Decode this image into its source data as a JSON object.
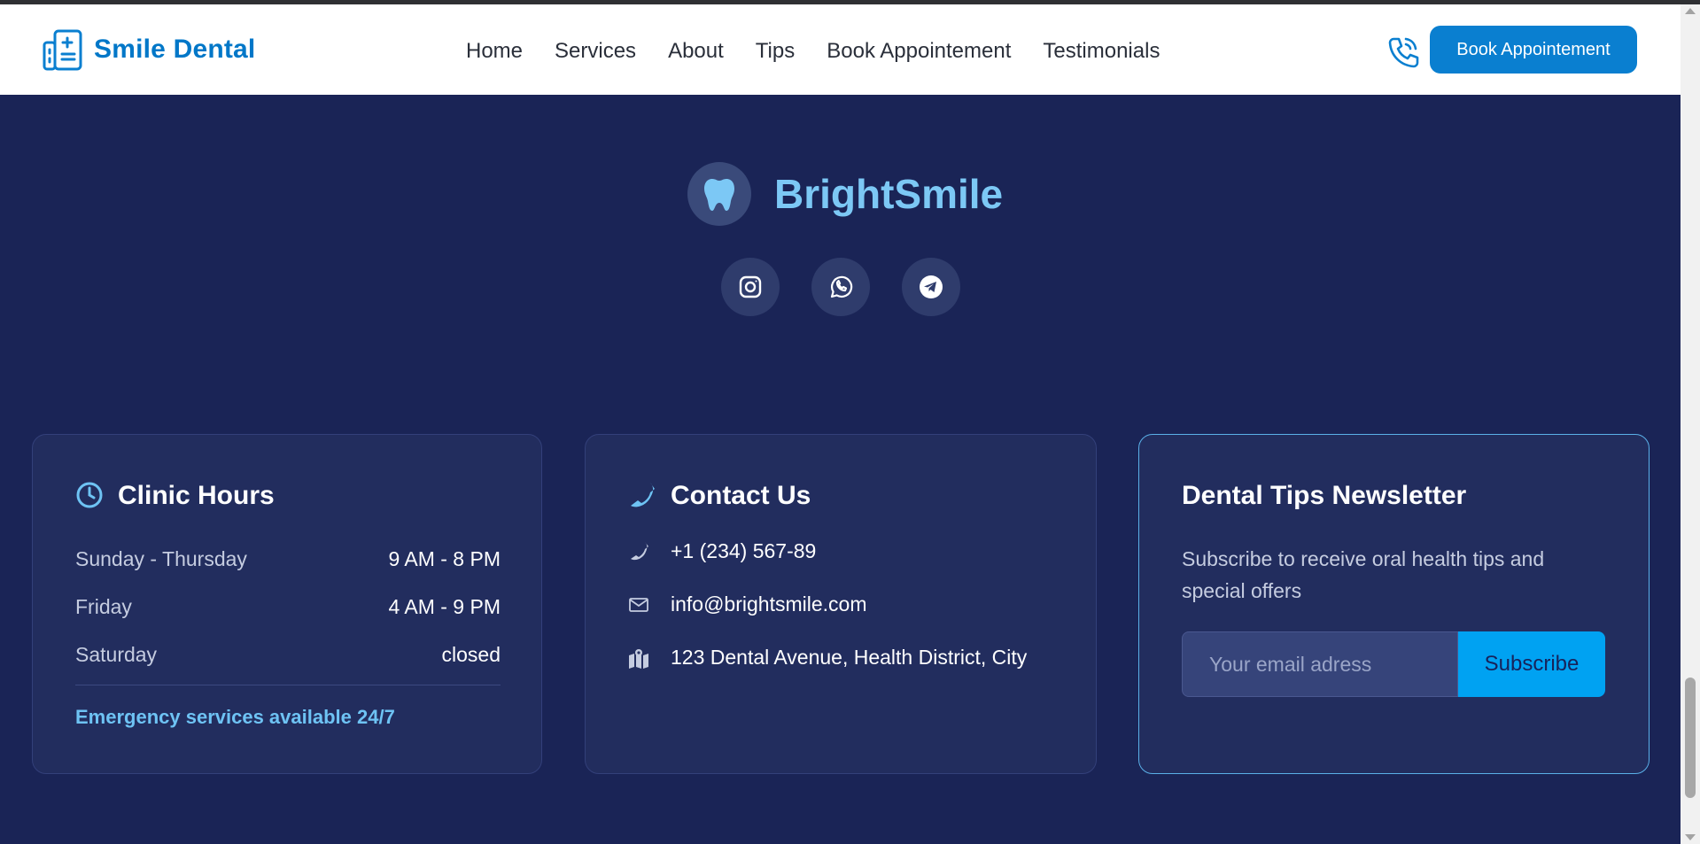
{
  "header": {
    "brand": "Smile Dental",
    "nav": [
      "Home",
      "Services",
      "About",
      "Tips",
      "Book Appointement",
      "Testimonials"
    ],
    "cta": "Book Appointement",
    "phone_icon": "phone-ringing-icon",
    "logo_icon": "hospital-building-icon"
  },
  "footer": {
    "brand": "BrightSmile",
    "brand_icon": "tooth-icon",
    "socials": [
      "instagram-icon",
      "whatsapp-icon",
      "telegram-icon"
    ]
  },
  "hours": {
    "title": "Clinic Hours",
    "rows": [
      {
        "day": "Sunday - Thursday",
        "time": "9 AM - 8 PM"
      },
      {
        "day": "Friday",
        "time": "4 AM - 9 PM"
      },
      {
        "day": "Saturday",
        "time": "closed"
      }
    ],
    "emergency": "Emergency services available 24/7"
  },
  "contact": {
    "title": "Contact Us",
    "phone": "+1 (234) 567-89",
    "email": "info@brightsmile.com",
    "address": "123 Dental Avenue, Health District, City"
  },
  "newsletter": {
    "title": "Dental Tips Newsletter",
    "description": "Subscribe to receive oral health tips and special offers",
    "placeholder": "Your email adress",
    "button": "Subscribe"
  },
  "colors": {
    "brand_blue": "#0077c8",
    "footer_bg": "#1a2456",
    "card_bg": "#222d5e",
    "accent_light": "#7cc8f5",
    "subscribe": "#00a2f2"
  }
}
